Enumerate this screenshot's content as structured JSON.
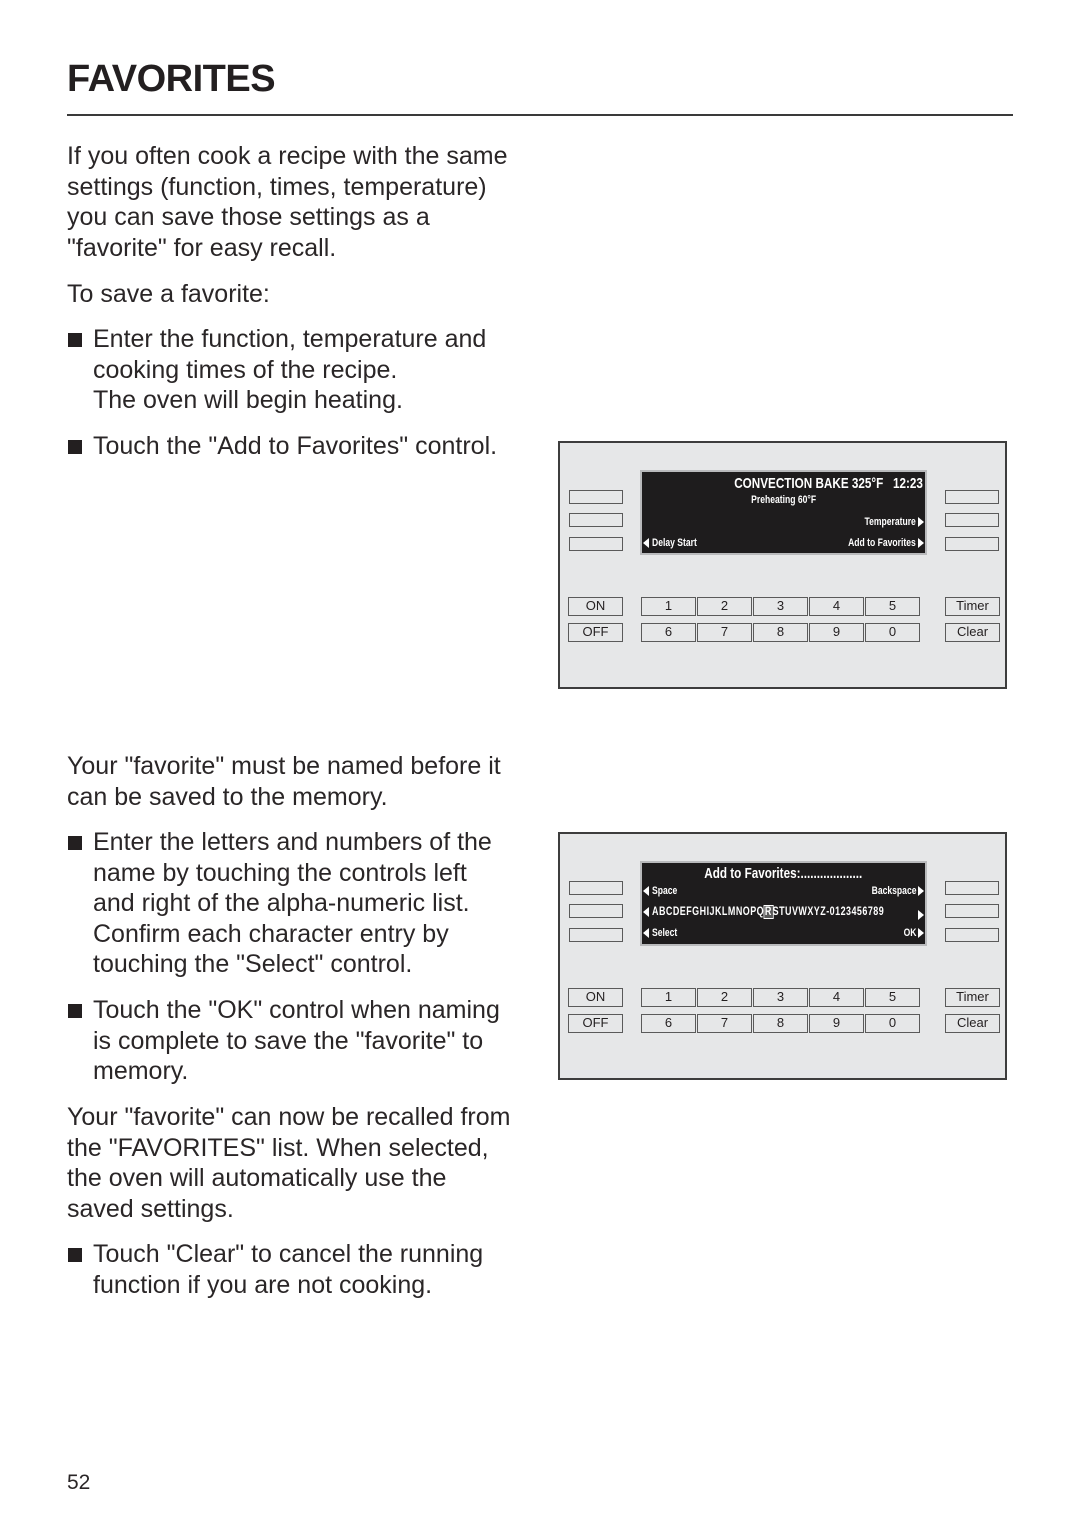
{
  "page": {
    "title": "FAVORITES",
    "page_number": "52"
  },
  "text": {
    "intro": "If you often cook a recipe with the same\nsettings (function, times, temperature)\nyou can save those settings as a\n\"favorite\" for easy recall.",
    "to_save": "To save a favorite:",
    "bullet1": "Enter the function, temperature and\ncooking times of the recipe.\nThe oven will begin heating.",
    "bullet2": "Touch the \"Add to Favorites\" control.",
    "naming_intro": "Your \"favorite\" must be named before it\ncan be saved to the memory.",
    "bullet3": "Enter the letters and numbers of the\nname by touching the controls left\nand right of the alpha-numeric list.\nConfirm each character entry by\ntouching the \"Select\" control.",
    "bullet4": "Touch the \"OK\" control when naming\nis complete to save the \"favorite\" to\nmemory.",
    "recall": "Your \"favorite\" can now be recalled from\nthe \"FAVORITES\" list. When selected,\nthe oven will automatically use the\nsaved settings.",
    "bullet5": "Touch \"Clear\" to cancel the running\nfunction if you are not cooking."
  },
  "panel1": {
    "display": {
      "mode": "CONVECTION BAKE 325°F",
      "clock": "12:23",
      "status": "Preheating 60°F",
      "right_option_2": "Temperature",
      "left_option_3": "Delay Start",
      "right_option_3": "Add to Favorites"
    }
  },
  "panel2": {
    "display": {
      "heading": "Add to Favorites:...................",
      "left_option_1": "Space",
      "right_option_1": "Backspace",
      "charset_before": "ABCDEFGHIJKLMNOPQ",
      "charset_selected": "R",
      "charset_after": "STUVWXYZ-0123456789",
      "left_option_3": "Select",
      "right_option_3": "OK"
    }
  },
  "keypad": {
    "on": "ON",
    "off": "OFF",
    "digits_row1": [
      "1",
      "2",
      "3",
      "4",
      "5"
    ],
    "digits_row2": [
      "6",
      "7",
      "8",
      "9",
      "0"
    ],
    "timer": "Timer",
    "clear": "Clear"
  },
  "colors": {
    "panel_bg": "#e6e7e8",
    "display_bg": "#1e1c1d",
    "text": "#231f20"
  }
}
